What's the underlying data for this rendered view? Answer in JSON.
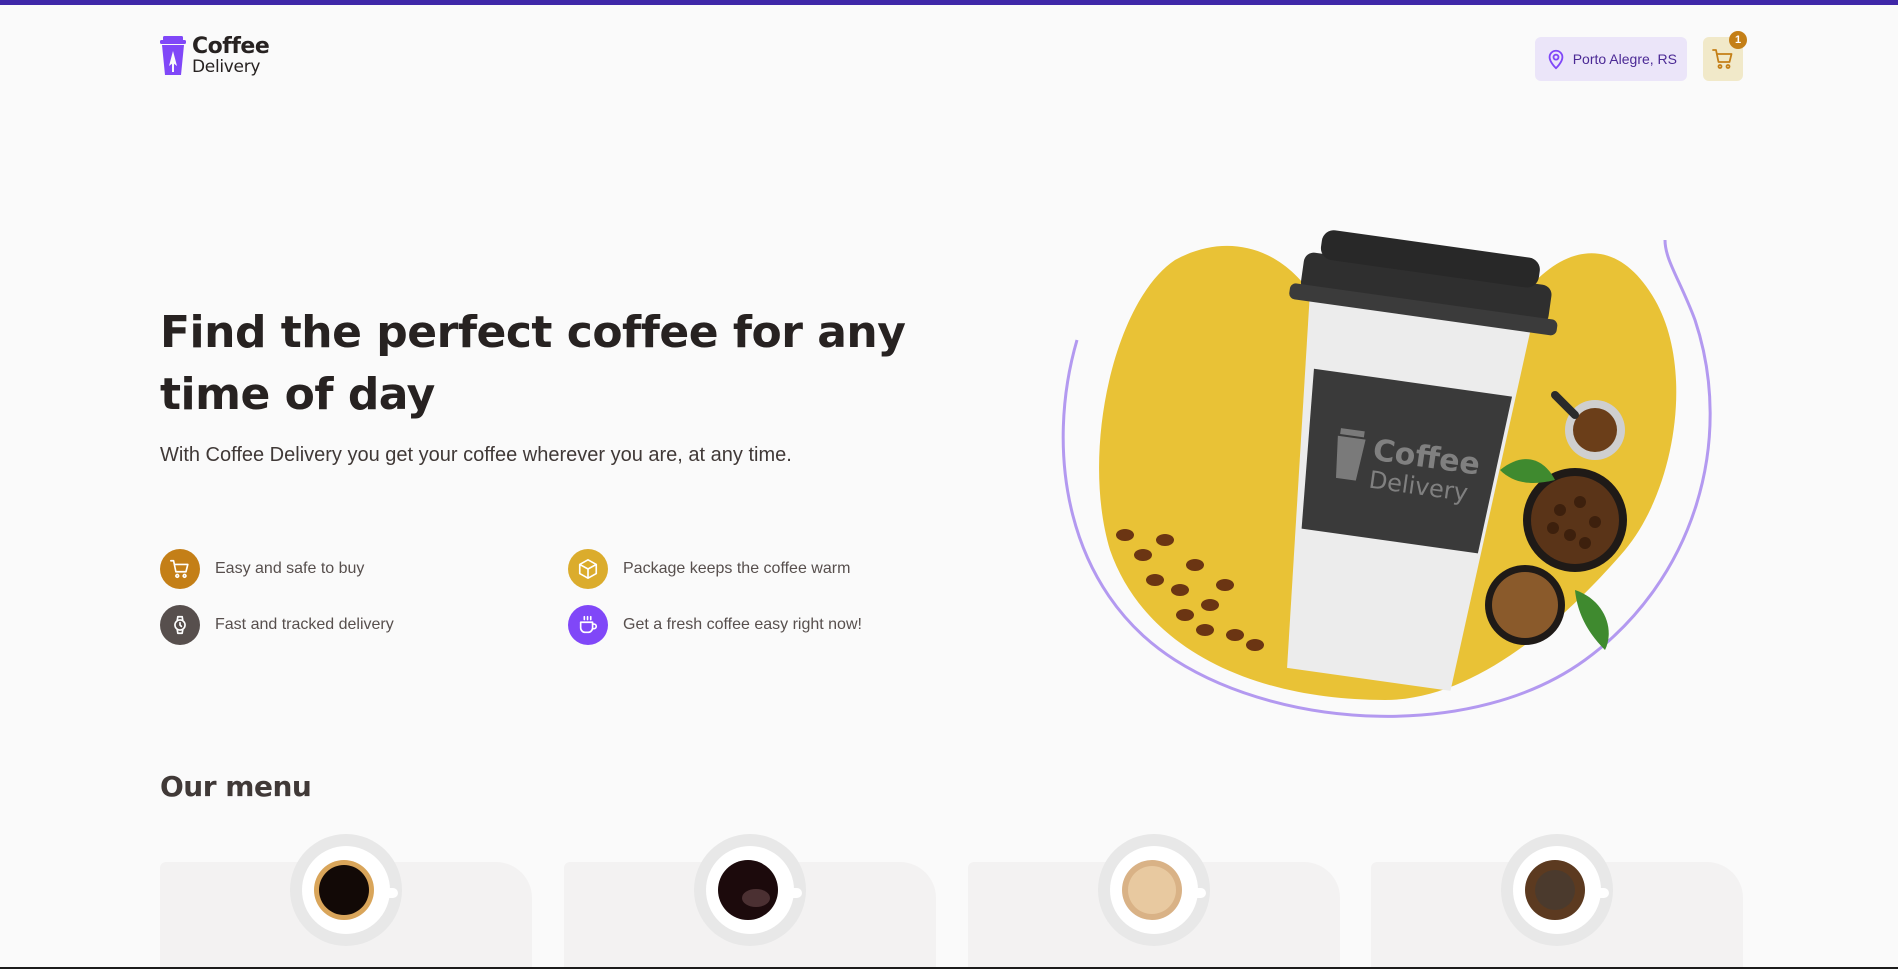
{
  "brand": {
    "line1": "Coffee",
    "line2": "Delivery",
    "color": "#8047F8"
  },
  "header": {
    "location": "Porto Alegre, RS",
    "cart_count": "1"
  },
  "hero": {
    "title": "Find the perfect coffee for any time of day",
    "subtitle": "With Coffee Delivery you get your coffee wherever you are, at any time.",
    "features": [
      {
        "label": "Easy and safe to buy",
        "icon": "cart-icon",
        "color": "#C47F17"
      },
      {
        "label": "Package keeps the coffee warm",
        "icon": "package-icon",
        "color": "#DBAC2C"
      },
      {
        "label": "Fast and tracked delivery",
        "icon": "watch-icon",
        "color": "#574F4D"
      },
      {
        "label": "Get a fresh coffee easy right now!",
        "icon": "coffee-cup-icon",
        "color": "#8047F8"
      }
    ],
    "cup_logo": {
      "line1": "Coffee",
      "line2": "Delivery"
    }
  },
  "menu": {
    "title": "Our menu",
    "items_count": 4
  },
  "colors": {
    "accent_purple": "#8047F8",
    "purple_dark": "#4B2995",
    "purple_light": "#EBE5F9",
    "yellow": "#DBAC2C",
    "yellow_dark": "#C47F17",
    "yellow_light": "#F1E9C9",
    "topbar": "#3F27A8"
  }
}
